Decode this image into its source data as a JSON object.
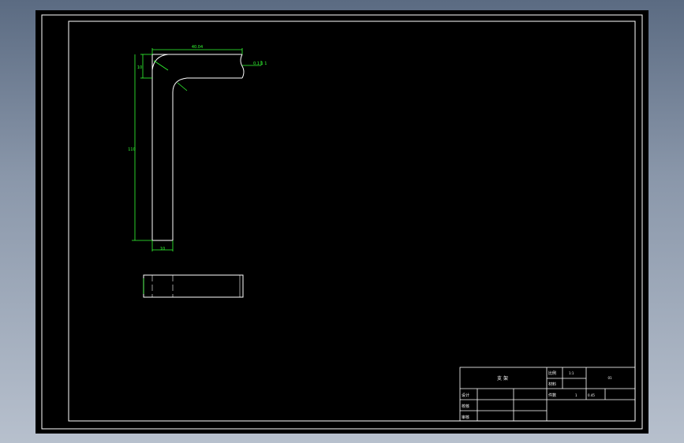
{
  "canvas": {
    "background": "#000000",
    "line_color": "#ffffff",
    "dimension_color": "#33ff33"
  },
  "dimensions": {
    "top_width": "40.04",
    "top_left_height": "10",
    "right_end_tolerance": "0.1 1 1",
    "vertical_length": "110",
    "bottom_width": "10"
  },
  "title_block": {
    "part_name": "支 架",
    "scale_label": "比例",
    "scale_value": "1:1",
    "material_label": "材料",
    "drawing_no": "01",
    "designer_label": "设计",
    "check_label": "校核",
    "review_label": "审核",
    "quantity_label": "件数",
    "quantity_value": "1",
    "weight_value": "0.45",
    "approve_label": "批准"
  }
}
